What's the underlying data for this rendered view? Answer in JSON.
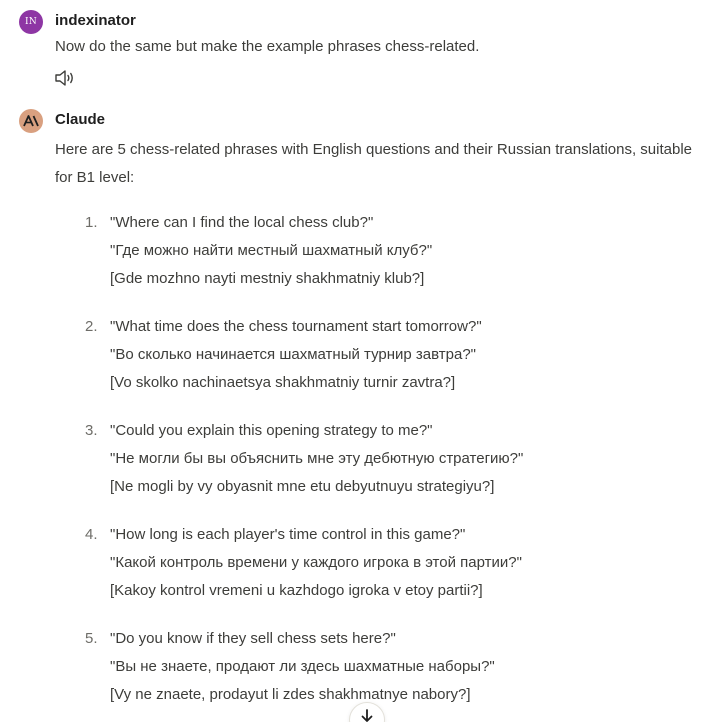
{
  "user": {
    "avatar_initials": "IN",
    "name": "indexinator",
    "message": "Now do the same but make the example phrases chess-related.",
    "avatar_color": "#8e36a4"
  },
  "assistant": {
    "avatar_glyph": "A\\",
    "name": "Claude",
    "avatar_color": "#d9a080",
    "intro": "Here are 5 chess-related phrases with English questions and their Russian translations, suitable for B1 level:",
    "phrases": [
      {
        "number": "1.",
        "english": "\"Where can I find the local chess club?\"",
        "russian": "\"Где можно найти местный шахматный клуб?\"",
        "translit": "[Gde mozhno nayti mestniy shakhmatniy klub?]"
      },
      {
        "number": "2.",
        "english": "\"What time does the chess tournament start tomorrow?\"",
        "russian": "\"Во сколько начинается шахматный турнир завтра?\"",
        "translit": "[Vo skolko nachinaetsya shakhmatniy turnir zavtra?]"
      },
      {
        "number": "3.",
        "english": "\"Could you explain this opening strategy to me?\"",
        "russian": "\"Не могли бы вы объяснить мне эту дебютную стратегию?\"",
        "translit": "[Ne mogli by vy obyasnit mne etu debyutnuyu strategiyu?]"
      },
      {
        "number": "4.",
        "english": "\"How long is each player's time control in this game?\"",
        "russian": "\"Какой контроль времени у каждого игрока в этой партии?\"",
        "translit": "[Kakoy kontrol vremeni u kazhdogo igroka v etoy partii?]"
      },
      {
        "number": "5.",
        "english": "\"Do you know if they sell chess sets here?\"",
        "russian": "\"Вы не знаете, продают ли здесь шахматные наборы?\"",
        "translit": "[Vy ne znaete, prodayut li zdes shakhmatnye nabory?]"
      }
    ]
  },
  "icons": {
    "read_aloud": "speaker-icon",
    "scroll_down": "arrow-down-icon"
  }
}
